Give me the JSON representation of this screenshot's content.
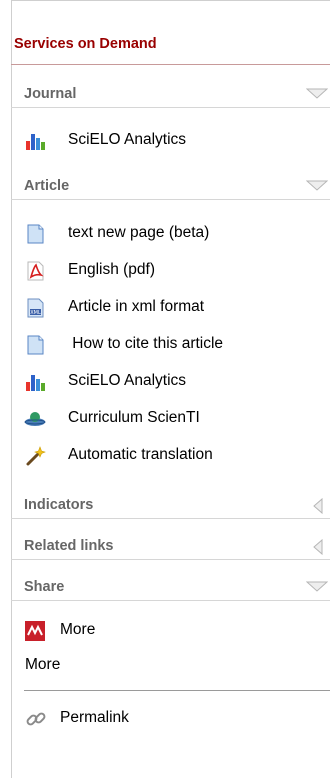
{
  "title": "Services on Demand",
  "sections": {
    "journal": "Journal",
    "article": "Article",
    "indicators": "Indicators",
    "related": "Related links",
    "share": "Share"
  },
  "journal_items": [
    "SciELO Analytics"
  ],
  "article_items": [
    {
      "label": "text new page (beta)",
      "icon": "page-icon"
    },
    {
      "label": "English (pdf)",
      "icon": "pdf-icon"
    },
    {
      "label": "Article in xml format",
      "icon": "xml-icon"
    },
    {
      "label": " How to cite this article",
      "icon": "page-icon"
    },
    {
      "label": "SciELO Analytics",
      "icon": "bar-chart-icon"
    },
    {
      "label": "Curriculum ScienTI",
      "icon": "curriculum-icon"
    },
    {
      "label": "Automatic translation",
      "icon": "magic-wand-icon"
    }
  ],
  "share": {
    "more_1": "More",
    "more_2": "More",
    "permalink": "Permalink"
  },
  "colors": {
    "title": "#990000",
    "section_label": "#666666"
  }
}
